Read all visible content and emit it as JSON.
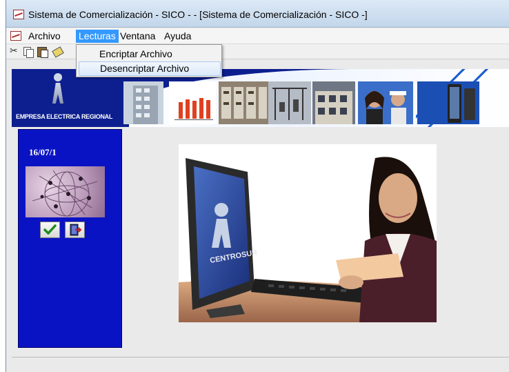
{
  "window": {
    "title": "Sistema de Comercialización - SICO - - [Sistema de Comercialización - SICO -]"
  },
  "menubar": {
    "items": [
      {
        "label": "Archivo"
      },
      {
        "label": "Lecturas",
        "active": true
      },
      {
        "label": "Ventana"
      },
      {
        "label": "Ayuda"
      }
    ]
  },
  "dropdown": {
    "items": [
      {
        "label": "Encriptar Archivo"
      },
      {
        "label": "Desencriptar Archivo",
        "highlighted": true
      }
    ]
  },
  "toolbar": {
    "icons": [
      "cut-icon",
      "copy-icon",
      "paste-icon",
      "edit-icon"
    ]
  },
  "banner": {
    "company": "EMPRESA ELECTRICA REGIONAL"
  },
  "sidebar": {
    "date": "16/07/1"
  },
  "colors": {
    "sidebar_bg": "#0a13c4",
    "banner_bg": "#0d1f8f",
    "menu_highlight": "#3399ff"
  }
}
